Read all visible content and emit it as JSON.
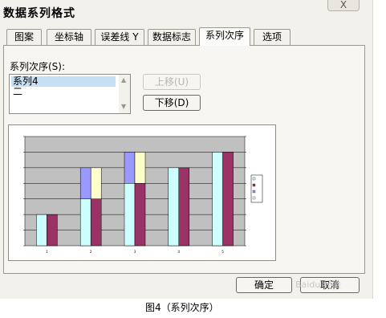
{
  "dialog": {
    "title": "数据系列格式",
    "close_label": "X",
    "tabs": [
      "图案",
      "坐标轴",
      "误差线 Y",
      "数据标志",
      "系列次序",
      "选项"
    ],
    "active_tab": "系列次序",
    "series_order_label": "系列次序(S):",
    "series_list": [
      "系列4",
      "二"
    ],
    "move_up_label": "上移(U)",
    "move_down_label": "下移(D)",
    "ok_label": "确定",
    "cancel_label": "取消"
  },
  "caption": "图4（系列次序）",
  "watermark": "Baidu 经验",
  "colors": {
    "plot_background": "#c0c0c0",
    "series_light_cyan": "#ccffff",
    "series_maroon": "#993366",
    "series_periwinkle": "#9999ff",
    "series_light_yellow": "#ffffcc"
  },
  "chart_data": {
    "type": "bar",
    "categories": [
      "1",
      "2",
      "3",
      "4",
      "5"
    ],
    "series": [
      {
        "values": [
          2,
          3,
          4,
          5,
          6
        ],
        "color": "#ccffff"
      },
      {
        "values": [
          2,
          3,
          4,
          5,
          6
        ],
        "color": "#993366"
      },
      {
        "values": [
          0,
          2,
          2,
          0,
          0
        ],
        "color": "#9999ff"
      },
      {
        "values": [
          0,
          2,
          2,
          0,
          0
        ],
        "color": "#ffffcc"
      }
    ],
    "ylim": [
      0,
      7
    ],
    "grid": true,
    "legend_position": "right"
  }
}
